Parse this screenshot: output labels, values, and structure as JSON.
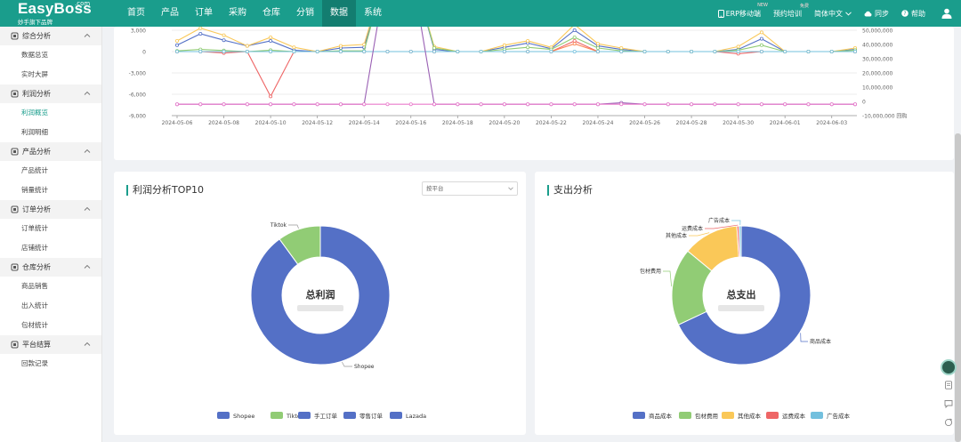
{
  "brand": {
    "name": "EasyBoss",
    "com": ".com",
    "slogan": "妙手旗下品牌"
  },
  "nav": [
    {
      "label": "首页"
    },
    {
      "label": "产品"
    },
    {
      "label": "订单"
    },
    {
      "label": "采购"
    },
    {
      "label": "仓库"
    },
    {
      "label": "分销"
    },
    {
      "label": "数据",
      "active": true
    },
    {
      "label": "系统"
    }
  ],
  "topright": {
    "erp": "ERP移动端",
    "erp_badge": "NEW",
    "training": "预约培训",
    "training_badge": "免费",
    "lang": "简体中文",
    "sync": "同步",
    "help": "帮助"
  },
  "sidebar": [
    {
      "label": "综合分析",
      "icon": "analytics-icon",
      "items": [
        {
          "label": "数据总览"
        },
        {
          "label": "实时大屏"
        }
      ]
    },
    {
      "label": "利润分析",
      "icon": "profit-icon",
      "items": [
        {
          "label": "利润概览",
          "active": true
        },
        {
          "label": "利润明细"
        }
      ]
    },
    {
      "label": "产品分析",
      "icon": "product-icon",
      "items": [
        {
          "label": "产品统计"
        },
        {
          "label": "销量统计"
        }
      ]
    },
    {
      "label": "订单分析",
      "icon": "bar-chart-icon",
      "items": [
        {
          "label": "订单统计"
        },
        {
          "label": "店铺统计"
        }
      ]
    },
    {
      "label": "仓库分析",
      "icon": "warehouse-icon",
      "items": [
        {
          "label": "商品销售"
        },
        {
          "label": "出入统计"
        },
        {
          "label": "包材统计"
        }
      ]
    },
    {
      "label": "平台结算",
      "icon": "settlement-icon",
      "items": [
        {
          "label": "回款记录"
        }
      ]
    }
  ],
  "colors": {
    "accent": "#1a9d8c",
    "nav_active": "#137d70"
  },
  "chart_data": [
    {
      "type": "line",
      "x": [
        "2024-05-06",
        "2024-05-07",
        "2024-05-08",
        "2024-05-09",
        "2024-05-10",
        "2024-05-11",
        "2024-05-12",
        "2024-05-13",
        "2024-05-14",
        "2024-05-15",
        "2024-05-16",
        "2024-05-17",
        "2024-05-18",
        "2024-05-19",
        "2024-05-20",
        "2024-05-21",
        "2024-05-22",
        "2024-05-23",
        "2024-05-24",
        "2024-05-25",
        "2024-05-26",
        "2024-05-27",
        "2024-05-28",
        "2024-05-29",
        "2024-05-30",
        "2024-05-31",
        "2024-06-01",
        "2024-06-02",
        "2024-06-03",
        "2024-06-04"
      ],
      "xticks": [
        "2024-05-06",
        "2024-05-08",
        "2024-05-10",
        "2024-05-12",
        "2024-05-14",
        "2024-05-16",
        "2024-05-18",
        "2024-05-20",
        "2024-05-22",
        "2024-05-24",
        "2024-05-26",
        "2024-05-28",
        "2024-05-30",
        "2024-06-01",
        "2024-06-03"
      ],
      "yticks_left": [
        "3,000",
        "0",
        "-3,000",
        "-6,000",
        "-9,000"
      ],
      "yticks_right": [
        "50,000,000",
        "40,000,000",
        "30,000,000",
        "20,000,000",
        "10,000,000",
        "0",
        "-10,000,000"
      ],
      "right_axis_suffix": "回购",
      "ylim": [
        -9000,
        3000
      ],
      "grid": true,
      "series": [
        {
          "color": "#5470c6",
          "values": [
            900,
            2500,
            1600,
            800,
            1500,
            200,
            0,
            500,
            600,
            12000,
            12000,
            300,
            0,
            0,
            600,
            1200,
            400,
            3000,
            800,
            300,
            0,
            0,
            0,
            0,
            300,
            1800,
            0,
            0,
            0,
            300
          ]
        },
        {
          "color": "#fac858",
          "values": [
            1500,
            3300,
            2300,
            800,
            2000,
            600,
            0,
            800,
            1000,
            12000,
            12000,
            700,
            0,
            0,
            900,
            1500,
            600,
            3800,
            1100,
            500,
            0,
            0,
            0,
            0,
            700,
            2700,
            0,
            0,
            0,
            500
          ]
        },
        {
          "color": "#ee6666",
          "values": [
            0,
            0,
            -200,
            0,
            -6300,
            0,
            0,
            0,
            0,
            0,
            0,
            0,
            0,
            0,
            0,
            0,
            0,
            1500,
            0,
            0,
            0,
            0,
            0,
            0,
            -300,
            0,
            0,
            0,
            0,
            0
          ]
        },
        {
          "color": "#fc8452",
          "values": [
            0,
            0,
            0,
            0,
            0,
            0,
            0,
            0,
            0,
            0,
            0,
            0,
            0,
            0,
            0,
            0,
            0,
            1100,
            0,
            0,
            0,
            0,
            0,
            0,
            0,
            0,
            0,
            0,
            0,
            0
          ]
        },
        {
          "color": "#91cc75",
          "values": [
            100,
            300,
            150,
            0,
            200,
            0,
            0,
            100,
            100,
            12000,
            12000,
            500,
            0,
            0,
            300,
            600,
            300,
            2000,
            500,
            100,
            0,
            0,
            0,
            0,
            200,
            900,
            0,
            0,
            0,
            200
          ]
        },
        {
          "color": "#73c0de",
          "values": [
            0,
            0,
            0,
            0,
            0,
            0,
            0,
            0,
            0,
            0,
            0,
            0,
            0,
            0,
            0,
            0,
            0,
            0,
            0,
            0,
            0,
            0,
            0,
            0,
            0,
            0,
            0,
            0,
            0,
            0
          ]
        },
        {
          "color": "#9a60b4",
          "values": [
            -7400,
            -7400,
            -7400,
            -7400,
            -7400,
            -7400,
            -7400,
            -7400,
            -7400,
            12000,
            12000,
            -7400,
            -7400,
            -7400,
            -7400,
            -7400,
            -7400,
            -7400,
            -7400,
            -7200,
            -7400,
            -7400,
            -7400,
            -7400,
            -7400,
            -7400,
            -7400,
            -7400,
            -7400,
            -7400
          ]
        },
        {
          "color": "#ea7ccc",
          "values": [
            -7400,
            -7400,
            -7400,
            -7400,
            -7400,
            -7400,
            -7400,
            -7400,
            -7400,
            -7400,
            -7400,
            -7400,
            -7400,
            -7400,
            -7400,
            -7400,
            -7400,
            -7400,
            -7400,
            -7400,
            -7400,
            -7400,
            -7400,
            -7400,
            -7400,
            -7400,
            -7400,
            -7400,
            -7400,
            -7400
          ]
        }
      ]
    },
    {
      "type": "pie",
      "title": "利润分析TOP10",
      "select_value": "按平台",
      "center_label": "总利润",
      "slices": [
        {
          "name": "Shopee",
          "value": 90,
          "color": "#5470c6"
        },
        {
          "name": "Tiktok",
          "value": 10,
          "color": "#91cc75"
        },
        {
          "name": "手工订单",
          "value": 0,
          "color": "#5470c6"
        },
        {
          "name": "零售订单",
          "value": 0,
          "color": "#5470c6"
        },
        {
          "name": "Lazada",
          "value": 0,
          "color": "#5470c6"
        }
      ],
      "labels_shown": [
        "Tiktok",
        "Shopee"
      ],
      "legend": "bottom"
    },
    {
      "type": "pie",
      "title": "支出分析",
      "center_label": "总支出",
      "slices": [
        {
          "name": "商品成本",
          "value": 68,
          "color": "#5470c6"
        },
        {
          "name": "包材费用",
          "value": 18,
          "color": "#91cc75"
        },
        {
          "name": "其他成本",
          "value": 13,
          "color": "#fac858"
        },
        {
          "name": "运费成本",
          "value": 0.5,
          "color": "#ee6666"
        },
        {
          "name": "广告成本",
          "value": 0.5,
          "color": "#73c0de"
        }
      ],
      "labels_shown": [
        "广告成本",
        "运费成本",
        "其他成本",
        "包材费用",
        "商品成本"
      ],
      "legend": "bottom"
    }
  ]
}
